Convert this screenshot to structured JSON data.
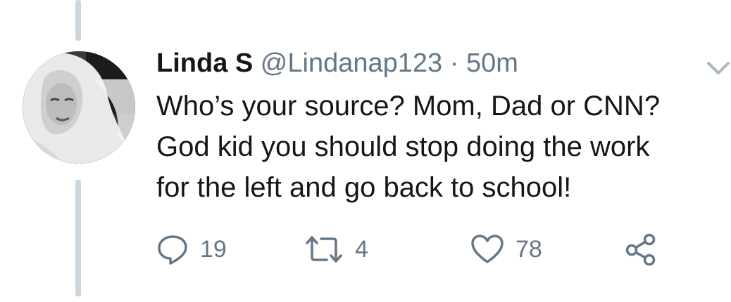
{
  "tweet": {
    "author": {
      "name": "Linda S",
      "handle": "@Lindanap123",
      "separator": "·",
      "time": "50m"
    },
    "text_lines": [
      "Who’s your source? Mom, Dad or CNN?",
      "God kid you should stop doing the work",
      "for the left and go back to school!"
    ],
    "actions": {
      "reply_count": "19",
      "retweet_count": "4",
      "like_count": "78"
    }
  },
  "icons": {
    "reply": "reply-icon",
    "retweet": "retweet-icon",
    "like": "heart-icon",
    "share": "share-icon",
    "menu": "chevron-down-icon"
  },
  "colors": {
    "text_primary": "#14171a",
    "text_secondary": "#657786",
    "thread_line": "#ccd6dd",
    "icon": "#657786"
  }
}
